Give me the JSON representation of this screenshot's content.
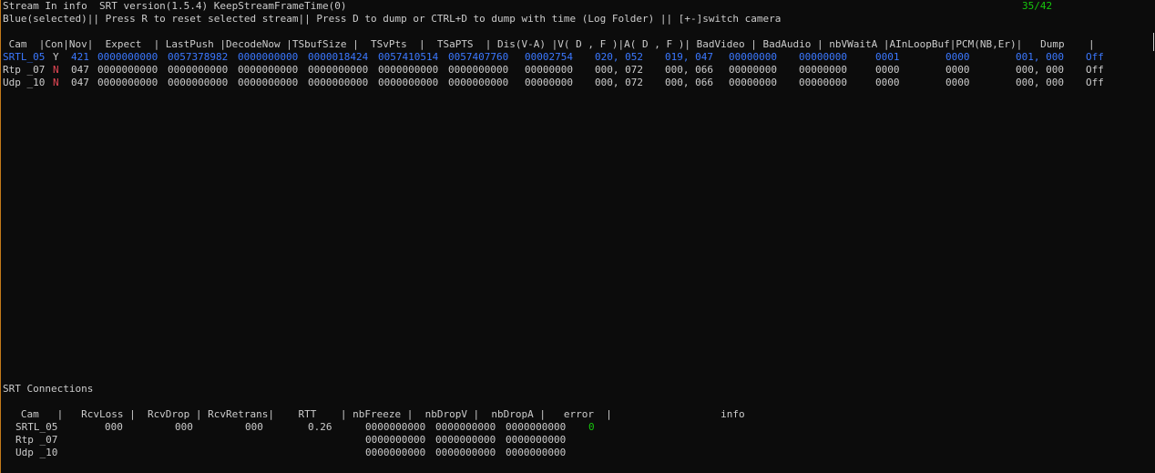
{
  "header": {
    "title_line": "Stream In info  SRT version(1.5.4) KeepStreamFrameTime(0)",
    "counter": "35/42",
    "help_line": "Blue(selected)|| Press R to reset selected stream|| Press D to dump or CTRL+D to dump with time (Log Folder) || [+-]switch camera"
  },
  "colors": {
    "selected": "#3b78ff",
    "disconnected": "#e74856",
    "ok": "#16c60c",
    "text": "#cccccc",
    "background": "#0c0c0c",
    "left_rule": "#c47a1a"
  },
  "stream_table": {
    "header_line": " Cam  |Con|Nov|  Expect  | LastPush |DecodeNow |TSbufSize |  TSvPts  |  TSaPTS  | Dis(V-A) |V( D , F )|A( D , F )| BadVideo | BadAudio | nbVWaitA |AInLoopBuf|PCM(NB,Er)|   Dump    |",
    "rows": [
      {
        "cam": "SRTL_05",
        "con": "Y",
        "nov": "421",
        "expect": "0000000000",
        "last_push": "0057378982",
        "decode_now": "0000000000",
        "tsbuf_size": "0000018424",
        "tsv_pts": "0057410514",
        "tsa_pts": "0057407760",
        "dis_va": "00002754",
        "v_df": "020, 052",
        "a_df": "019, 047",
        "bad_video": "00000000",
        "bad_audio": "00000000",
        "nb_vwait_a": "0001",
        "ain_loop_buf": "0000",
        "pcm": "001, 000",
        "dump": "Off",
        "selected": true
      },
      {
        "cam": "Rtp _07",
        "con": "N",
        "nov": "047",
        "expect": "0000000000",
        "last_push": "0000000000",
        "decode_now": "0000000000",
        "tsbuf_size": "0000000000",
        "tsv_pts": "0000000000",
        "tsa_pts": "0000000000",
        "dis_va": "00000000",
        "v_df": "000, 072",
        "a_df": "000, 066",
        "bad_video": "00000000",
        "bad_audio": "00000000",
        "nb_vwait_a": "0000",
        "ain_loop_buf": "0000",
        "pcm": "000, 000",
        "dump": "Off",
        "selected": false
      },
      {
        "cam": "Udp _10",
        "con": "N",
        "nov": "047",
        "expect": "0000000000",
        "last_push": "0000000000",
        "decode_now": "0000000000",
        "tsbuf_size": "0000000000",
        "tsv_pts": "0000000000",
        "tsa_pts": "0000000000",
        "dis_va": "00000000",
        "v_df": "000, 072",
        "a_df": "000, 066",
        "bad_video": "00000000",
        "bad_audio": "00000000",
        "nb_vwait_a": "0000",
        "ain_loop_buf": "0000",
        "pcm": "000, 000",
        "dump": "Off",
        "selected": false
      }
    ]
  },
  "srt_connections": {
    "title": "SRT Connections",
    "header_line": "   Cam   |   RcvLoss |  RcvDrop | RcvRetrans|    RTT    | nbFreeze |  nbDropV |  nbDropA |   error  |                  info",
    "rows": [
      {
        "cam": "SRTL_05",
        "rcv_loss": "000",
        "rcv_drop": "000",
        "rcv_retrans": "000",
        "rtt": "0.26",
        "nb_freeze": "0000000000",
        "nb_drop_v": "0000000000",
        "nb_drop_a": "0000000000",
        "error": "0"
      },
      {
        "cam": "Rtp _07",
        "rcv_loss": "",
        "rcv_drop": "",
        "rcv_retrans": "",
        "rtt": "",
        "nb_freeze": "0000000000",
        "nb_drop_v": "0000000000",
        "nb_drop_a": "0000000000",
        "error": ""
      },
      {
        "cam": "Udp _10",
        "rcv_loss": "",
        "rcv_drop": "",
        "rcv_retrans": "",
        "rtt": "",
        "nb_freeze": "0000000000",
        "nb_drop_v": "0000000000",
        "nb_drop_a": "0000000000",
        "error": ""
      }
    ]
  }
}
